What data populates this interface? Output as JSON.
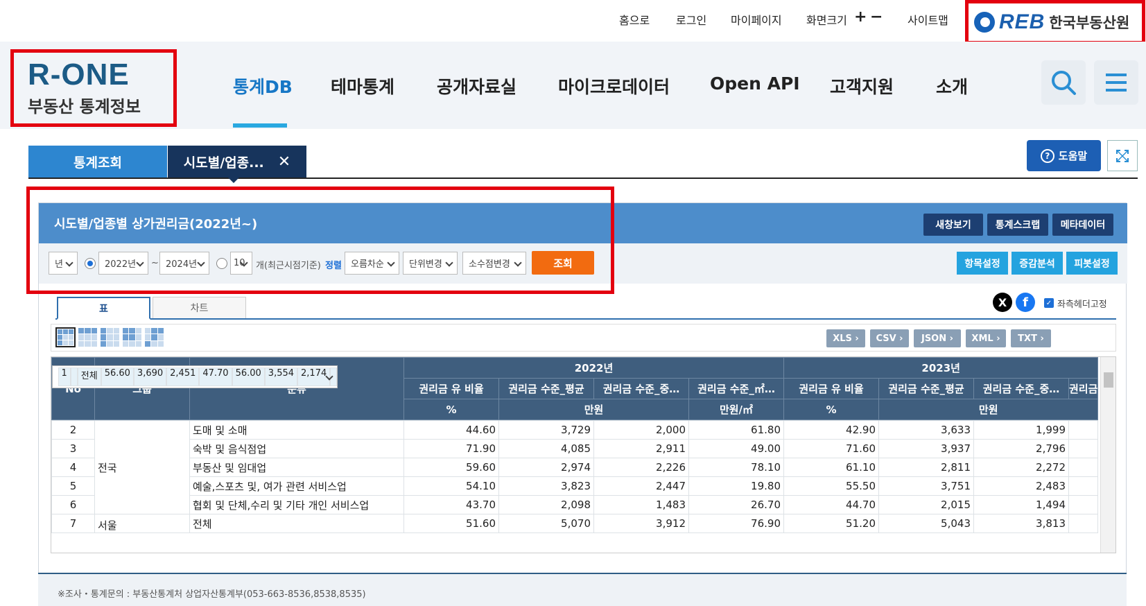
{
  "utility_nav": {
    "home": "홈으로",
    "login": "로그인",
    "mypage": "마이페이지",
    "font_size": "화면크기",
    "sitemap": "사이트맵"
  },
  "reb": {
    "mark": "REB",
    "name": "한국부동산원"
  },
  "logo": {
    "main": "R-ONE",
    "sub": "부동산 통계정보"
  },
  "main_nav": [
    "통계DB",
    "테마통계",
    "공개자료실",
    "마이크로데이터",
    "Open API",
    "고객지원",
    "소개"
  ],
  "tabs": {
    "search": "통계조회",
    "current": "시도별/업종..."
  },
  "help": "도움말",
  "panel": {
    "title": "시도별/업종별 상가권리금(2022년~)",
    "new_window": "새창보기",
    "scrap": "통계스크랩",
    "metadata": "메타데이터"
  },
  "controls": {
    "period_unit": "년",
    "from_year": "2022년",
    "tilde": "~",
    "to_year": "2024년",
    "recent_count": "10",
    "recent_label": "개(최근시점기준)",
    "sort_label": "정렬",
    "sort_order": "오름차순",
    "unit_change": "단위변경",
    "decimal_change": "소수점변경",
    "search": "조회",
    "item_setting": "항목설정",
    "change_analysis": "증감분석",
    "pivot": "피봇설정"
  },
  "view_tabs": {
    "table": "표",
    "chart": "차트"
  },
  "fix_header": "좌측헤더고정",
  "export": [
    "XLS",
    "CSV",
    "JSON",
    "XML",
    "TXT"
  ],
  "table": {
    "col_no": "No",
    "col_group": "그룹",
    "col_category": "분류",
    "years": [
      "2022년",
      "2023년"
    ],
    "measures": [
      "권리금 유 비율",
      "권리금 수준_평균",
      "권리금 수준_중…",
      "권리금 수준_㎡…",
      "권리금 유 비율",
      "권리금 수준_평균",
      "권리금 수준_중…",
      "권리금"
    ],
    "units": [
      "%",
      "만원",
      "만원/㎡",
      "%",
      "만원"
    ],
    "group_jeonguk": "전국",
    "group_seoul": "서울",
    "rows": [
      {
        "no": "1",
        "cat": "전체",
        "v": [
          "56.60",
          "3,690",
          "2,451",
          "47.70",
          "56.00",
          "3,554",
          "2,174",
          ""
        ]
      },
      {
        "no": "2",
        "cat": "도매 및 소매",
        "v": [
          "44.60",
          "3,729",
          "2,000",
          "61.80",
          "42.90",
          "3,633",
          "1,999",
          ""
        ]
      },
      {
        "no": "3",
        "cat": "숙박 및 음식점업",
        "v": [
          "71.90",
          "4,085",
          "2,911",
          "49.00",
          "71.60",
          "3,937",
          "2,796",
          ""
        ]
      },
      {
        "no": "4",
        "cat": "부동산 및 임대업",
        "v": [
          "59.60",
          "2,974",
          "2,226",
          "78.10",
          "61.10",
          "2,811",
          "2,272",
          ""
        ]
      },
      {
        "no": "5",
        "cat": "예술,스포츠 및, 여가 관련 서비스업",
        "v": [
          "54.10",
          "3,823",
          "2,447",
          "19.80",
          "55.50",
          "3,751",
          "2,483",
          ""
        ]
      },
      {
        "no": "6",
        "cat": "협회 및 단체,수리 및 기타 개인 서비스업",
        "v": [
          "43.70",
          "2,098",
          "1,483",
          "26.70",
          "44.70",
          "2,015",
          "1,494",
          ""
        ]
      },
      {
        "no": "7",
        "cat": "전체",
        "v": [
          "51.60",
          "5,070",
          "3,912",
          "76.90",
          "51.20",
          "5,043",
          "3,813",
          ""
        ]
      }
    ]
  },
  "footer_note": "※조사・통계문의 : 부동산통계처 상업자산통계부(053-663-8536,8538,8535)",
  "colors": {
    "accent": "#1777c6",
    "panel_head": "#4d8dcb",
    "search_btn": "#f26b10",
    "highlight": "#e3000f"
  }
}
